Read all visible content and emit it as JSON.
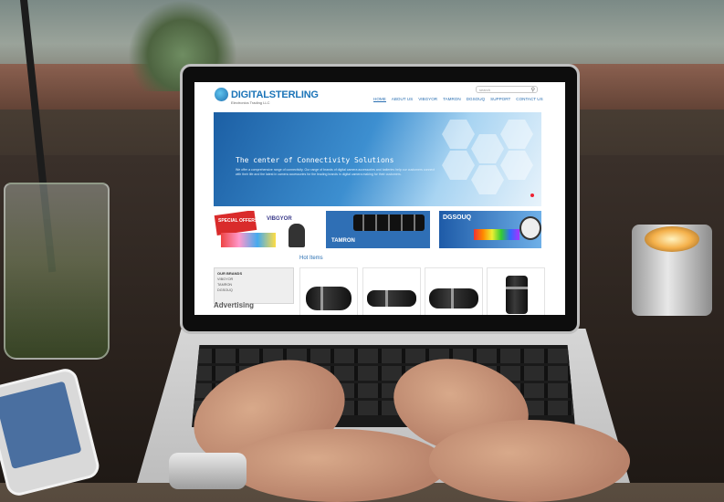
{
  "site": {
    "logo_text": "DIGITALSTERLING",
    "logo_subtitle": "Electronics Trading LLC",
    "search_placeholder": "search",
    "nav": [
      "HOME",
      "ABOUT US",
      "VIBGYOR",
      "TAMRON",
      "DGSOUQ",
      "SUPPORT",
      "CONTACT US"
    ],
    "banner_title": "The center of Connectivity Solutions",
    "banner_text": "We offer a comprehensive range of connectivity. Our range of brands of digital camera accessories and batteries help our customers connect with their life and the latest in camera accessories for the leading brands in digital camera making for their customers.",
    "promo": {
      "special_offers": "SPECIAL OFFERS",
      "vibgyor": "VIBGYOR",
      "tamron": "TAMRON",
      "dgsouq": "DGSOUQ"
    },
    "hot_items_title": "Hot Items",
    "brands_title": "OUR BRANDS",
    "brands": [
      "VIBGYOR",
      "TAMRON",
      "DGSOUQ"
    ],
    "advertising_title": "Advertising"
  },
  "colors": {
    "brand_blue": "#1b74b8",
    "banner_blue": "#1c5fa4"
  }
}
